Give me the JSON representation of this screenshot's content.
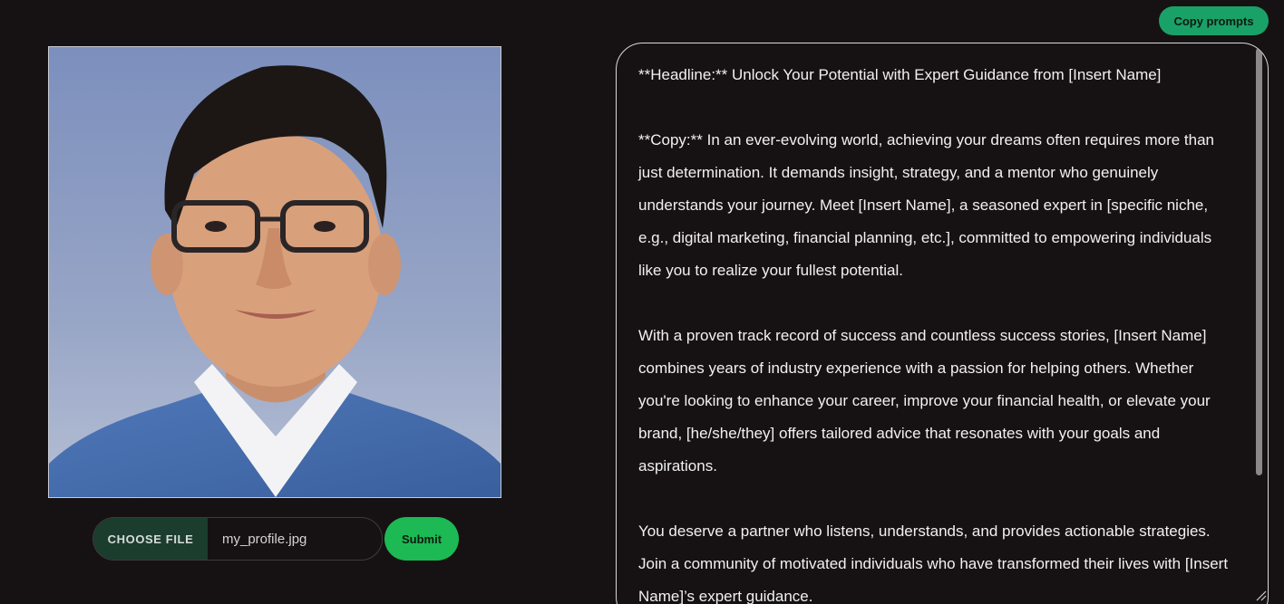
{
  "photo": {
    "alt": "Profile photo"
  },
  "upload": {
    "choose_label": "CHOOSE FILE",
    "file_name": "my_profile.jpg",
    "submit_label": "Submit"
  },
  "toolbar": {
    "copy_label": "Copy prompts"
  },
  "output": {
    "paragraphs": [
      "**Headline:** Unlock Your Potential with Expert Guidance from [Insert Name]",
      "**Copy:** In an ever-evolving world, achieving your dreams often requires more than just determination. It demands insight, strategy, and a mentor who genuinely understands your journey. Meet [Insert Name], a seasoned expert in [specific niche, e.g., digital marketing, financial planning, etc.], committed to empowering individuals like you to realize your fullest potential.",
      "With a proven track record of success and countless success stories, [Insert Name] combines years of industry experience with a passion for helping others. Whether you're looking to enhance your career, improve your financial health, or elevate your brand, [he/she/they] offers tailored advice that resonates with your goals and aspirations.",
      "You deserve a partner who listens, understands, and provides actionable strategies. Join a community of motivated individuals who have transformed their lives with [Insert Name]’s expert guidance."
    ]
  },
  "colors": {
    "background": "#161213",
    "accent_green": "#1db954",
    "copy_button": "#1aa168",
    "choose_file_bg": "#1b3d2e"
  }
}
